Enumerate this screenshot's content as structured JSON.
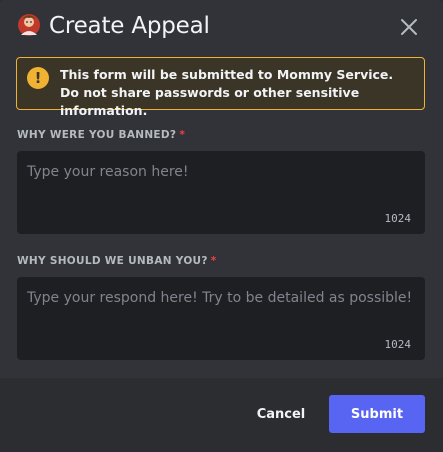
{
  "dialog": {
    "title": "Create Appeal",
    "avatar_icon": "server-avatar-icon",
    "close_icon": "close-icon"
  },
  "notice": {
    "icon": "warning-icon",
    "icon_glyph": "!",
    "text_before": "This form will be submitted to ",
    "service_name": "Mommy Service",
    "text_after": ". Do not share passwords or other sensitive information."
  },
  "questions": [
    {
      "label": "Why were you banned?",
      "required_mark": "*",
      "placeholder": "Type your reason here!",
      "value": "",
      "char_limit": "1024"
    },
    {
      "label": "Why should we unban you?",
      "required_mark": "*",
      "placeholder": "Type your respond here! Try to be detailed as possible!",
      "value": "",
      "char_limit": "1024"
    }
  ],
  "footer": {
    "cancel_label": "Cancel",
    "submit_label": "Submit"
  },
  "colors": {
    "modal_bg": "#313338",
    "footer_bg": "#2b2d31",
    "input_bg": "#1e1f22",
    "warning": "#f0b232",
    "required": "#f23f43",
    "brand": "#5865f2"
  }
}
